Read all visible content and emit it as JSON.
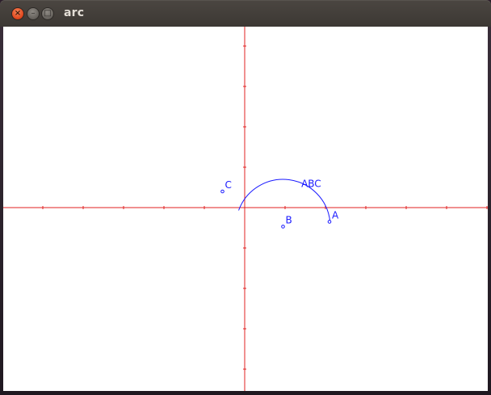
{
  "window": {
    "title": "arc",
    "close_glyph": "×",
    "minimize_glyph": "–",
    "maximize_glyph": "□"
  },
  "colors": {
    "axis": "#e02020",
    "figure": "#1a1aff",
    "canvas_background": "#ffffff"
  },
  "plot": {
    "axis_x_range": [
      -6,
      6
    ],
    "axis_y_range": [
      -4.5,
      4.5
    ],
    "tick_step": 1,
    "points": [
      {
        "label": "A",
        "x": 2.1,
        "y": -0.35
      },
      {
        "label": "B",
        "x": 0.95,
        "y": -0.47
      },
      {
        "label": "C",
        "x": -0.55,
        "y": 0.4
      }
    ],
    "arc": {
      "label": "ABC",
      "center": [
        0.95,
        -0.47
      ],
      "radius": 1.17,
      "start_angle_deg": 160,
      "end_angle_deg": 5.5
    }
  }
}
